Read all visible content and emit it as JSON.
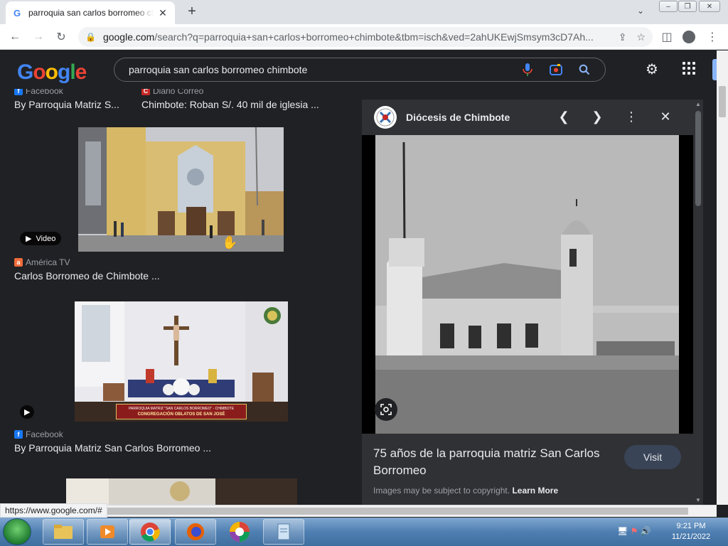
{
  "browser": {
    "tab_title": "parroquia san carlos borromeo chimbote - Google Search",
    "tab_close": "✕",
    "new_tab": "+",
    "url_domain": "google.com",
    "url_path": "/search?q=parroquia+san+carlos+borromeo+chimbote&tbm=isch&ved=2ahUKEwjSmsym3cD7Ah..."
  },
  "google": {
    "query": "parroquia san carlos borromeo chimbote",
    "logo_text": [
      "G",
      "o",
      "o",
      "g",
      "l",
      "e"
    ]
  },
  "results": [
    {
      "source": "Facebook",
      "caption": "By Parroquia Matriz S..."
    },
    {
      "source": "Diario Correo",
      "caption": "Chimbote: Roban S/. 40 mil de iglesia ..."
    },
    {
      "badge": "Video",
      "source": "América TV",
      "caption": "Carlos Borromeo de Chimbote ..."
    },
    {
      "banner_line1": "PARROQUIA MATRIZ \"SAN CARLOS BORROMEO\" - CHIMBOTE",
      "banner_line2": "CONGREGACIÓN OBLATOS DE SAN JOSÉ",
      "source": "Facebook",
      "caption": "By Parroquia Matriz San Carlos Borromeo ..."
    }
  ],
  "panel": {
    "site": "Diócesis de Chimbote",
    "title": "75 años de la parroquia matriz San Carlos Borromeo",
    "visit_label": "Visit",
    "copyright": "Images may be subject to copyright.",
    "learn_more": "Learn More"
  },
  "status_url": "https://www.google.com/#",
  "clock": {
    "time": "9:21 PM",
    "date": "11/21/2022"
  },
  "colors": {
    "bg": "#202124",
    "panel": "#303134",
    "visit": "#394457"
  }
}
